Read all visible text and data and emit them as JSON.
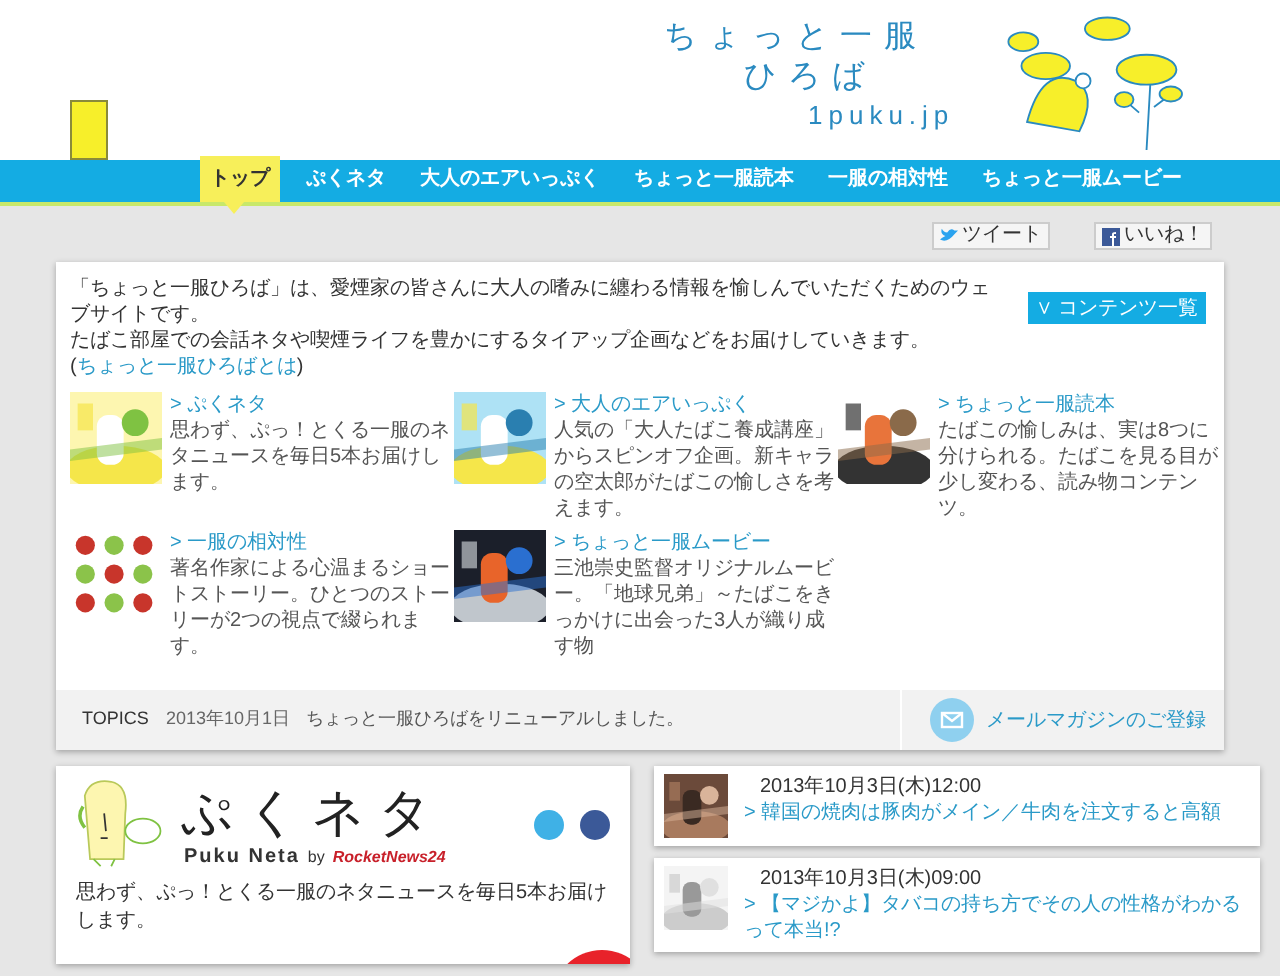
{
  "header": {
    "logo_lines": [
      "ちょっと一服",
      "ひろば",
      "1puku.jp"
    ]
  },
  "nav": [
    {
      "label": "トップ",
      "selected": true
    },
    {
      "label": "ぷくネタ",
      "selected": false
    },
    {
      "label": "大人のエアいっぷく",
      "selected": false
    },
    {
      "label": "ちょっと一服読本",
      "selected": false
    },
    {
      "label": "一服の相対性",
      "selected": false
    },
    {
      "label": "ちょっと一服ムービー",
      "selected": false
    }
  ],
  "social": {
    "tweet": "ツイート",
    "like": "いいね！"
  },
  "intro": {
    "line_1": "「ちょっと一服ひろば」は、愛煙家の皆さんに大人の嗜みに纏わる情報を愉しんでいただくためのウェブサイトです。",
    "line_2": "たばこ部屋での会話ネタや喫煙ライフを豊かにするタイアップ企画などをお届けしていきます。(",
    "link": "ちょっと一服ひろばとは",
    "after": ")",
    "button": "∨ コンテンツ一覧"
  },
  "contents": [
    {
      "title": "> ぷくネタ",
      "text": "思わず、ぷっ！とくる一服のネタニュースを毎日5本お届けします。",
      "kind": "picture"
    },
    {
      "title": "> 大人のエアいっぷく",
      "text": "人気の「大人たばこ養成講座」からスピンオフ企画。新キャラの空太郎がたばこの愉しさを考えます。",
      "kind": "picture"
    },
    {
      "title": "> ちょっと一服読本",
      "text": "たばこの愉しみは、実は8つに分けられる。たばこを見る目が少し変わる、読み物コンテンツ。",
      "kind": "picture"
    },
    {
      "title": "> 一服の相対性",
      "text": "著名作家による心温まるショートストーリー。ひとつのストーリーが2つの視点で綴られます。",
      "kind": "picture"
    },
    {
      "title": "> ちょっと一服ムービー",
      "text": "三池崇史監督オリジナルムービー。「地球兄弟」～たばこをきっかけに出会った3人が織り成す物",
      "kind": "picture"
    }
  ],
  "topics": {
    "label": "TOPICS",
    "date": "2013年10月1日",
    "text": "ちょっと一服ひろばをリニューアルしました。",
    "mail": "メールマガジンのご登録"
  },
  "puku_neta": {
    "logo": "ぷくネタ",
    "romaji": "Puku Neta",
    "by": "by",
    "partner": "RocketNews24",
    "description": "思わず、ぷっ！とくる一服のネタニュースを毎日5本お届けします。"
  },
  "news": [
    {
      "date": "2013年10月3日(木)12:00",
      "title": "> 韓国の焼肉は豚肉がメイン／牛肉を注文すると高額"
    },
    {
      "date": "2013年10月3日(木)09:00",
      "title": "> 【マジかよ】タバコの持ち方でその人の性格がわかるって本当!?"
    }
  ]
}
